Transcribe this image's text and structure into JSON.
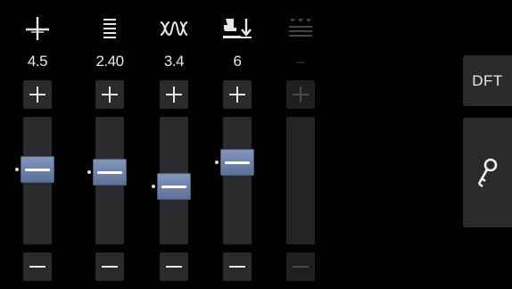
{
  "columns": [
    {
      "id": "stitch-width",
      "icon": "needle-position-icon",
      "value": "4.5",
      "enabled": true,
      "level": 0.61,
      "default_level": 0.61
    },
    {
      "id": "stitch-length",
      "icon": "stitch-length-icon",
      "value": "2.40",
      "enabled": true,
      "level": 0.58,
      "default_level": 0.58
    },
    {
      "id": "thread-tension",
      "icon": "thread-tension-icon",
      "value": "3.4",
      "enabled": true,
      "level": 0.44,
      "default_level": 0.44
    },
    {
      "id": "presser-foot-pressure",
      "icon": "presser-foot-pressure-icon",
      "value": "6",
      "enabled": true,
      "level": 0.68,
      "default_level": 0.68
    },
    {
      "id": "feed-dogs",
      "icon": "feed-dogs-icon",
      "value": "–",
      "enabled": false,
      "level": null,
      "default_level": null
    }
  ],
  "side": {
    "dft_label": "DFT",
    "key_icon": "key-icon"
  },
  "colors": {
    "background": "#000000",
    "button": "#2a2a2d",
    "thumb_top": "#8296be",
    "thumb_bottom": "#5c6f97",
    "text": "#e8e8e8",
    "disabled": "#3a3a3c"
  }
}
